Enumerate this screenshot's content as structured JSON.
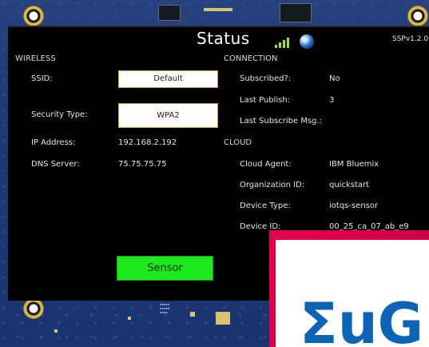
{
  "header": {
    "title": "Status",
    "version": "SSPv1.2.0",
    "signal_icon": "signal-bars-icon",
    "globe_icon": "globe-icon",
    "signal_color": "#9be03a"
  },
  "wireless": {
    "heading": "WIRELESS",
    "ssid_label": "SSID:",
    "ssid_value": "Default",
    "security_label": "Security Type:",
    "security_value": "WPA2",
    "ip_label": "IP Address:",
    "ip_value": "192.168.2.192",
    "dns_label": "DNS Server:",
    "dns_value": "75.75.75.75"
  },
  "connection": {
    "heading": "CONNECTION",
    "subscribed_label": "Subscribed?:",
    "subscribed_value": "No",
    "last_publish_label": "Last Publish:",
    "last_publish_value": "3",
    "last_subscribe_label": "Last Subscribe Msg.:",
    "last_subscribe_value": ""
  },
  "cloud": {
    "heading": "CLOUD",
    "agent_label": "Cloud Agent:",
    "agent_value": "IBM Bluemix",
    "org_label": "Organization ID:",
    "org_value": "quickstart",
    "device_type_label": "Device Type:",
    "device_type_value": "iotqs-sensor",
    "device_id_label": "Device ID:",
    "device_id_value": "00_25_ca_07_ab_e9"
  },
  "sensor_button": {
    "label": "Sensor",
    "color": "#1ee81e"
  },
  "logo": {
    "text": "ΣuG",
    "brand_color": "#e6004f"
  }
}
